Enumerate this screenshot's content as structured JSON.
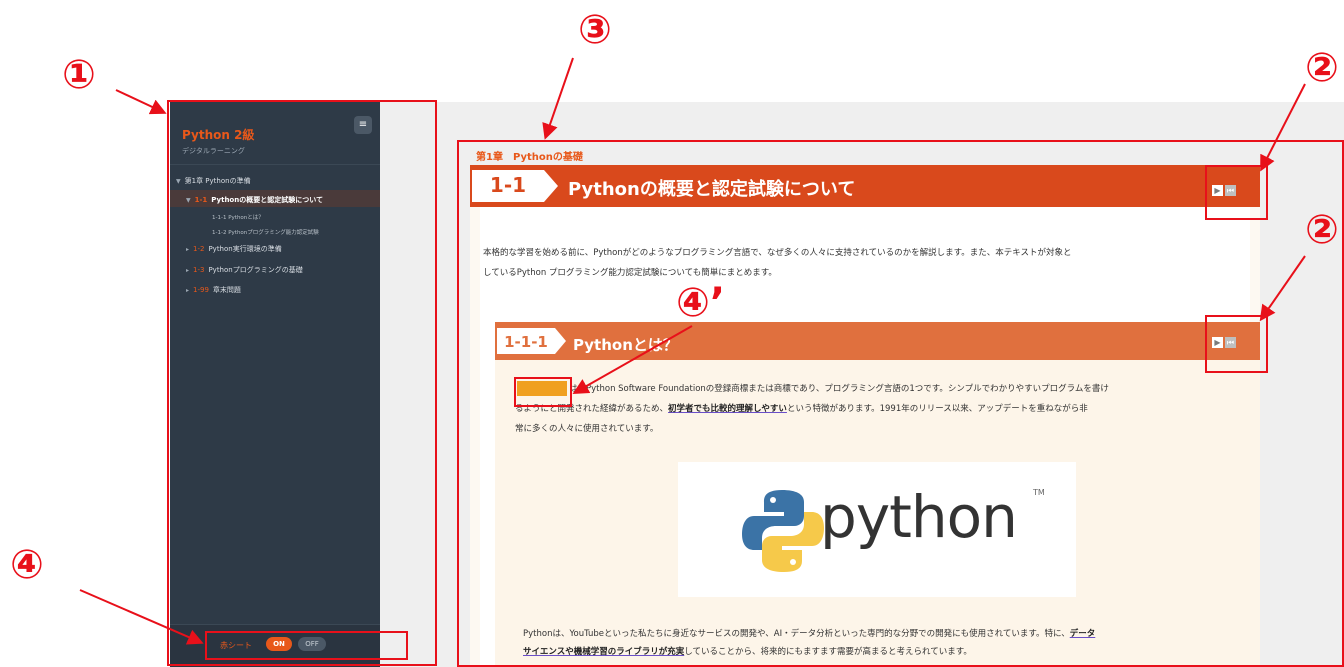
{
  "marks": {
    "m1": "①",
    "m2a": "②",
    "m2b": "②",
    "m3": "③",
    "m4": "④",
    "m4p": "④’"
  },
  "sidebar": {
    "title": "Python 2級",
    "subtitle": "デジタルラーニング",
    "menu_icon": "≡",
    "items": [
      {
        "arrow": "▼",
        "num": "",
        "label": "第1章 Pythonの準備"
      },
      {
        "arrow": "▼",
        "num": "1-1",
        "label": "Pythonの概要と認定試験について"
      },
      {
        "arrow": "▸",
        "num": "1-2",
        "label": "Python実行環境の準備"
      },
      {
        "arrow": "▸",
        "num": "1-3",
        "label": "Pythonプログラミングの基礎"
      },
      {
        "arrow": "▸",
        "num": "1-99",
        "label": "章末問題"
      }
    ],
    "subitems": [
      "1-1-1 Pythonとは？",
      "1-1-2 Pythonプログラミング能力認定試験"
    ],
    "sheet_label": "赤シート",
    "on_label": "ON",
    "off_label": "OFF"
  },
  "main": {
    "chapter": "第1章　Pythonの基礎",
    "section_num": "1-1",
    "section_title": "Pythonの概要と認定試験について",
    "intro_line1": "本格的な学習を始める前に、Pythonがどのようなプログラミング言語で、なぜ多くの人々に支持されているのかを解説します。また、本テキストが対象と",
    "intro_line2": "しているPython プログラミング能力認定試験についても簡単にまとめます。",
    "sub_num": "1-1-1",
    "sub_title": "Pythonとは？",
    "p1_line1_post": "は、Python Software Foundationの登録商標または商標であり、プログラミング言語の1つです。シンプルでわかりやすいプログラムを書け",
    "p1_line2_pre": "るようにと開発された経緯があるため、",
    "p1_line2_ul": "初学者でも比較的理解しやすい",
    "p1_line2_post": "という特徴があります。1991年のリリース以来、アップデートを重ねながら非",
    "p1_line3": "常に多くの人々に使用されています。",
    "logo_text": "python",
    "logo_tm": "TM",
    "p2_line1_pre": "Pythonは、YouTubeといった私たちに身近なサービスの開発や、AI・データ分析といった専門的な分野での開発にも使用されています。特に、",
    "p2_line1_ul": "データ",
    "p2_line2_ul": "サイエンスや機械学習のライブラリが充実",
    "p2_line2_post": "していることから、将来的にもますます需要が高まると考えられています。",
    "play_icon": "▶",
    "rewind_icon": "⏮"
  },
  "colors": {
    "annotation": "#e8101a",
    "accent": "#d9491c",
    "sidebar_bg": "#2e3a47"
  }
}
